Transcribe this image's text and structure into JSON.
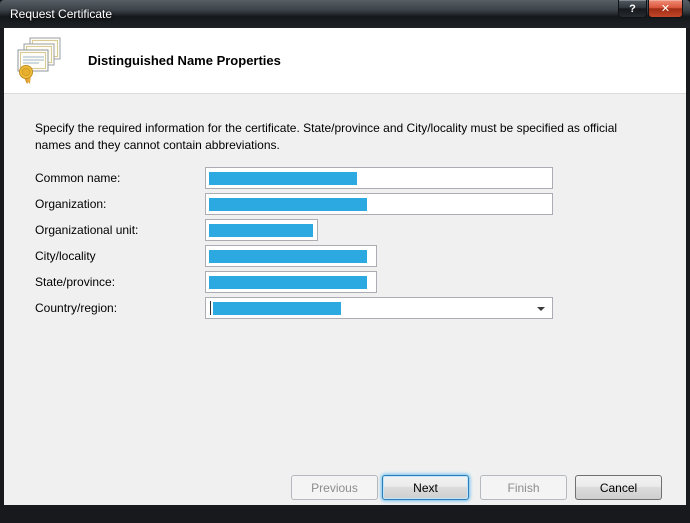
{
  "window": {
    "title": "Request Certificate"
  },
  "titlebar": {
    "help_glyph": "?",
    "close_glyph": "✕"
  },
  "header": {
    "title": "Distinguished Name Properties"
  },
  "body": {
    "instructions": "Specify the required information for the certificate. State/province and City/locality must be specified as official names and they cannot contain abbreviations."
  },
  "fields": [
    {
      "label": "Common name:",
      "type": "text",
      "value_masked": true
    },
    {
      "label": "Organization:",
      "type": "text",
      "value_masked": true
    },
    {
      "label": "Organizational unit:",
      "type": "text",
      "value_masked": true
    },
    {
      "label": "City/locality",
      "type": "text",
      "value_masked": true
    },
    {
      "label": "State/province:",
      "type": "text",
      "value_masked": true
    },
    {
      "label": "Country/region:",
      "type": "select",
      "value_masked": true
    }
  ],
  "buttons": [
    {
      "label": "Previous",
      "state": "disabled"
    },
    {
      "label": "Next",
      "state": "default-focused"
    },
    {
      "label": "Finish",
      "state": "disabled"
    },
    {
      "label": "Cancel",
      "state": "enabled"
    }
  ],
  "colors": {
    "masked_value_blue": "#2ca9e1",
    "default_button_border": "#2d7cb5",
    "body_background": "#f0f0f0"
  }
}
